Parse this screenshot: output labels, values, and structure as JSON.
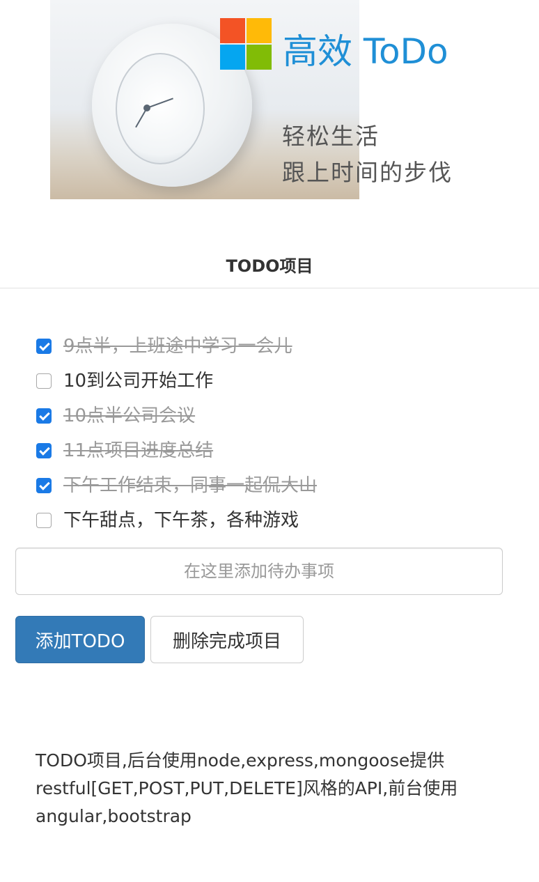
{
  "banner": {
    "logo_text": "高效 ToDo",
    "slogan_line1": "轻松生活",
    "slogan_line2": "跟上时间的步伐"
  },
  "section": {
    "title": "TODO项目"
  },
  "todos": [
    {
      "text": "9点半，上班途中学习一会儿",
      "done": true
    },
    {
      "text": "10到公司开始工作",
      "done": false
    },
    {
      "text": "10点半公司会议",
      "done": true
    },
    {
      "text": "11点项目进度总结",
      "done": true
    },
    {
      "text": "下午工作结束，同事一起侃大山",
      "done": true
    },
    {
      "text": "下午甜点，下午茶，各种游戏",
      "done": false
    }
  ],
  "add_form": {
    "placeholder": "在这里添加待办事项",
    "add_button": "添加TODO",
    "delete_button": "删除完成项目"
  },
  "footer": {
    "description": "TODO项目,后台使用node,express,mongoose提供restful[GET,POST,PUT,DELETE]风格的API,前台使用angular,bootstrap"
  },
  "colors": {
    "primary": "#337ab7",
    "checkbox_checked": "#1a7ae6",
    "logo_text": "#1f8fd6"
  }
}
